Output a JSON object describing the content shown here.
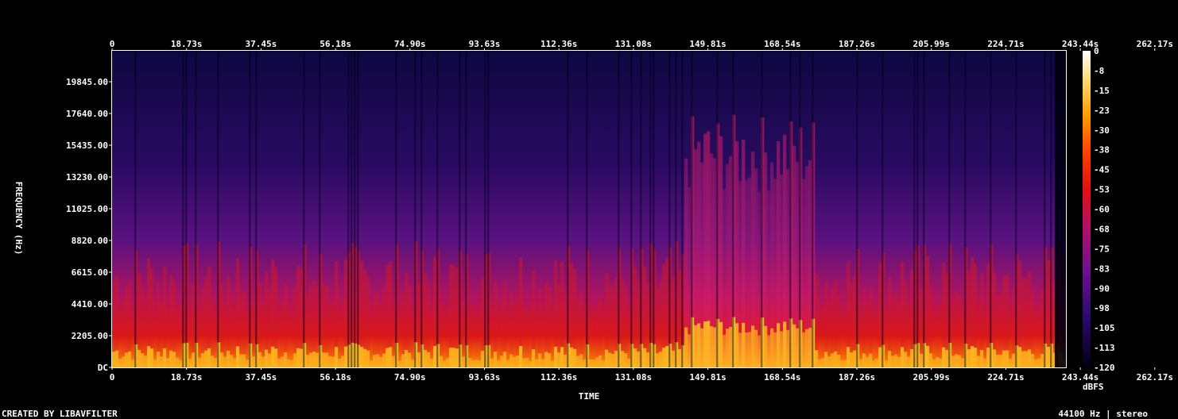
{
  "chart_data": {
    "type": "heatmap",
    "xlabel": "TIME",
    "ylabel": "FREQUENCY (Hz)",
    "x_ticks": [
      "0",
      "18.73s",
      "37.45s",
      "56.18s",
      "74.90s",
      "93.63s",
      "112.36s",
      "131.08s",
      "149.81s",
      "168.54s",
      "187.26s",
      "205.99s",
      "224.71s",
      "243.44s",
      "262.17s"
    ],
    "y_ticks": [
      "DC",
      "2205.00",
      "4410.00",
      "6615.00",
      "8820.00",
      "11025.00",
      "13230.00",
      "15435.00",
      "17640.00",
      "19845.00"
    ],
    "xlim": [
      0,
      281
    ],
    "ylim": [
      0,
      22050
    ],
    "colorbar": {
      "label": "dBFS",
      "ticks": [
        "0",
        "-8",
        "-15",
        "-23",
        "-30",
        "-38",
        "-45",
        "-53",
        "-60",
        "-68",
        "-75",
        "-83",
        "-90",
        "-98",
        "-105",
        "-113",
        "-120"
      ],
      "range": [
        -120,
        0
      ]
    },
    "colors": {
      "background": "#000000",
      "low": "#000010",
      "mid_low": "#3b0a7a",
      "mid": "#a01870",
      "mid_high": "#e01810",
      "high": "#ffb000",
      "peak": "#ffffff"
    }
  },
  "footer": {
    "left": "CREATED BY LIBAVFILTER",
    "right": "44100 Hz | stereo"
  }
}
